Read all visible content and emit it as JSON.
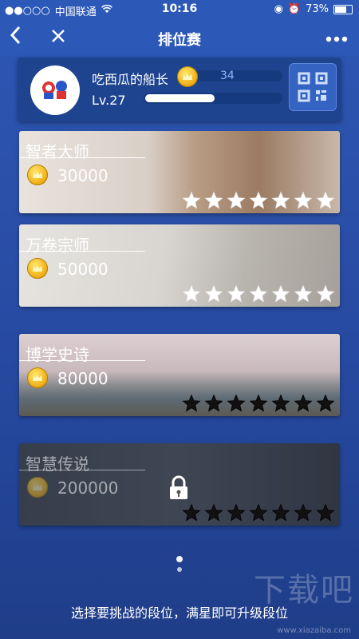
{
  "status_bar": {
    "carrier": "中国联通",
    "signal": "●●○○○",
    "time": "10:16",
    "battery": "73%"
  },
  "nav": {
    "back_icon": "‹",
    "close_icon": "✕",
    "title": "排位赛",
    "more_icon": "•••"
  },
  "profile": {
    "name": "吃西瓜的船长",
    "level": "Lv.27",
    "coins": "34",
    "exp_fraction": 0.5
  },
  "ranks": [
    {
      "name": "智者大师",
      "price": "30000",
      "stars_filled": 7,
      "stars_total": 7,
      "locked": false
    },
    {
      "name": "万卷宗师",
      "price": "50000",
      "stars_filled": 7,
      "stars_total": 7,
      "locked": false
    },
    {
      "name": "博学史诗",
      "price": "80000",
      "stars_filled": 0,
      "stars_total": 7,
      "locked": false
    },
    {
      "name": "智慧传说",
      "price": "200000",
      "stars_filled": 0,
      "stars_total": 7,
      "locked": true
    }
  ],
  "hint": "选择要挑战的段位，满星即可升级段位",
  "watermark": "下载吧",
  "watermark_url": "www.xiazaiba.com",
  "colors": {
    "accent": "#2c58b8",
    "coin": "#f2b31a"
  }
}
